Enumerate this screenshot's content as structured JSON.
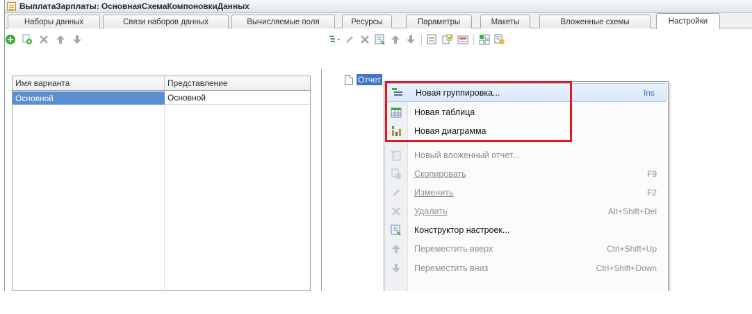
{
  "window": {
    "title": "ВыплатаЗарплаты: ОсновнаяСхемаКомпоновкиДанных"
  },
  "tabs": [
    {
      "label": "Наборы данных"
    },
    {
      "label": "Связи наборов данных"
    },
    {
      "label": "Вычисляемые поля"
    },
    {
      "label": "Ресурсы"
    },
    {
      "label": "Параметры"
    },
    {
      "label": "Макеты"
    },
    {
      "label": "Вложенные схемы"
    },
    {
      "label": "Настройки",
      "active": true
    }
  ],
  "variants_table": {
    "columns": [
      "Имя варианта",
      "Представление"
    ],
    "rows": [
      {
        "name": "Основной",
        "presentation": "Основной"
      }
    ]
  },
  "tree": {
    "root_label": "Отчет"
  },
  "context_menu": {
    "items": [
      {
        "label": "Новая группировка...",
        "shortcut": "Ins",
        "enabled": true,
        "icon": "grouping-icon"
      },
      {
        "label": "Новая таблица",
        "shortcut": "",
        "enabled": true,
        "icon": "table-icon"
      },
      {
        "label": "Новая диаграмма",
        "shortcut": "",
        "enabled": true,
        "icon": "chart-icon"
      },
      {
        "label": "Новый вложенный отчет...",
        "shortcut": "",
        "enabled": false,
        "icon": "nested-report-icon"
      },
      {
        "label": "Скопировать",
        "shortcut": "F9",
        "enabled": false,
        "icon": "copy-icon"
      },
      {
        "label": "Изменить",
        "shortcut": "F2",
        "enabled": false,
        "icon": "edit-icon"
      },
      {
        "label": "Удалить",
        "shortcut": "Alt+Shift+Del",
        "enabled": false,
        "icon": "delete-icon"
      },
      {
        "label": "Конструктор настроек...",
        "shortcut": "",
        "enabled": true,
        "icon": "settings-wizard-icon"
      },
      {
        "label": "Переместить вверх",
        "shortcut": "Ctrl+Shift+Up",
        "enabled": false,
        "icon": "arrow-up-icon"
      },
      {
        "label": "Переместить вниз",
        "shortcut": "Ctrl+Shift+Down",
        "enabled": false,
        "icon": "arrow-down-icon"
      }
    ]
  },
  "colors": {
    "selection": "#5b8ed3",
    "highlight_border": "#e8141e",
    "menu_hover": "#d9e8fa"
  }
}
